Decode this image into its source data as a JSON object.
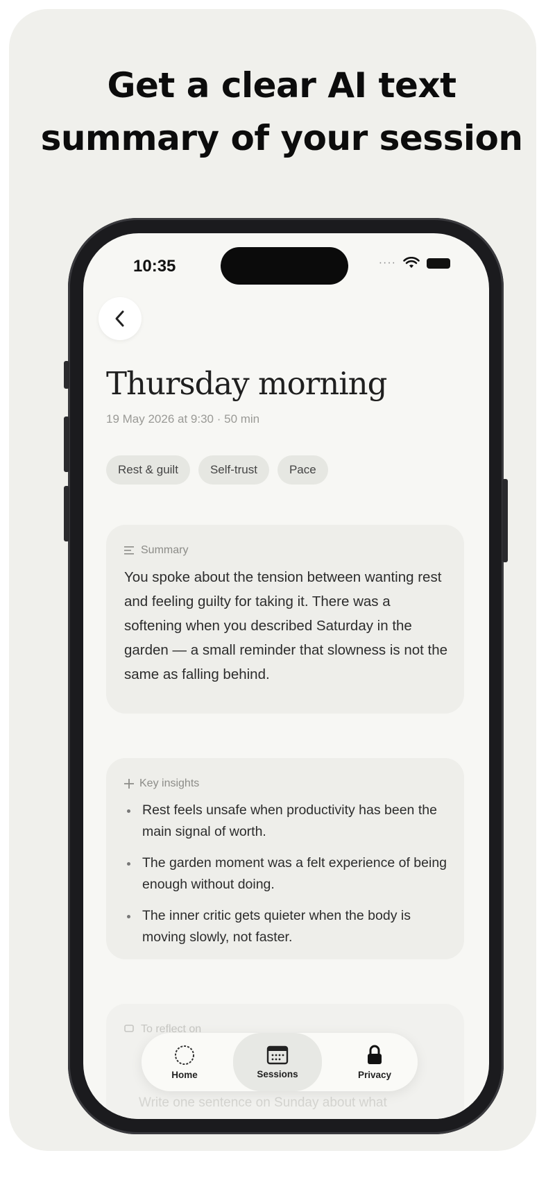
{
  "headline": {
    "line1": "Get a clear AI text",
    "line2": "summary of your session"
  },
  "status_bar": {
    "time": "10:35"
  },
  "session": {
    "title": "Thursday morning",
    "meta": "19 May 2026 at 9:30 · 50 min",
    "tags": [
      "Rest & guilt",
      "Self-trust",
      "Pace"
    ]
  },
  "summary": {
    "label": "Summary",
    "text": "You spoke about the tension between wanting rest and feeling guilty for taking it. There was a softening when you described Saturday in the garden — a small reminder that slowness is not the same as falling behind."
  },
  "insights": {
    "label": "Key insights",
    "items": [
      "Rest feels unsafe when productivity has been the main signal of worth.",
      "The garden moment was a felt experience of being enough without doing.",
      "The inner critic gets quieter when the body is moving slowly, not faster."
    ]
  },
  "reflect": {
    "label": "To reflect on",
    "partial_text": "Write one sentence on Sunday about what"
  },
  "tabbar": {
    "tabs": [
      {
        "label": "Home",
        "icon": "circle-icon"
      },
      {
        "label": "Sessions",
        "icon": "calendar-icon"
      },
      {
        "label": "Privacy",
        "icon": "lock-icon"
      }
    ],
    "active": "Sessions"
  },
  "colors": {
    "background_card": "#f0f0ec",
    "phone_frame": "#1b1b1e",
    "screen": "#f7f7f4",
    "panel": "#eeeeea",
    "tag": "#e6e7e2"
  }
}
